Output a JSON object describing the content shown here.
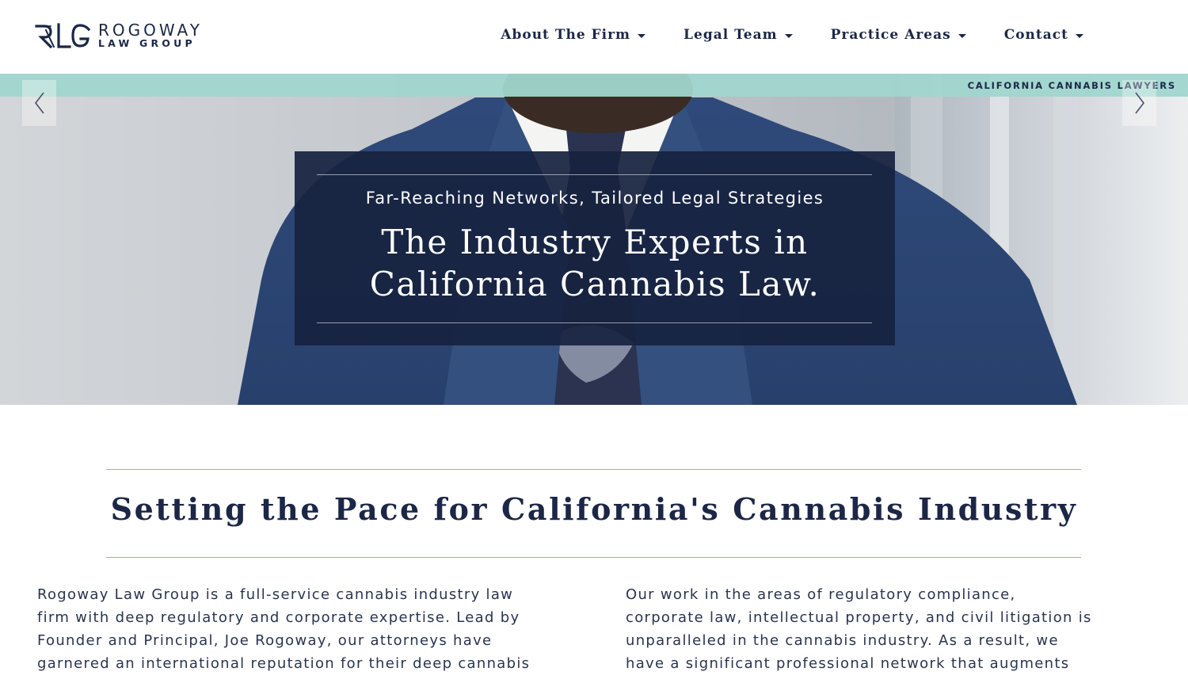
{
  "header": {
    "logo": {
      "mark": "RLG",
      "line1": "ROGOWAY",
      "line2": "LAW GROUP"
    },
    "nav": [
      {
        "label": "About The Firm"
      },
      {
        "label": "Legal Team"
      },
      {
        "label": "Practice Areas"
      },
      {
        "label": "Contact"
      }
    ]
  },
  "hero": {
    "ribbon_text": "CALIFORNIA CANNABIS LAWYERS",
    "kicker": "Far-Reaching Networks, Tailored Legal Strategies",
    "title_line1": "The Industry Experts in",
    "title_line2": "California Cannabis Law.",
    "prev_icon": "chevron-left-icon",
    "next_icon": "chevron-right-icon"
  },
  "intro": {
    "title": "Setting the Pace for California's Cannabis Industry",
    "left_lines": [
      "Rogoway Law Group is a full-service cannabis industry law",
      "firm with deep regulatory and corporate expertise. Lead by",
      "Founder and Principal, Joe Rogoway, our attorneys have",
      "garnered an international reputation for their deep cannabis"
    ],
    "right_lines": [
      "Our work in the areas of regulatory compliance,",
      "corporate law, intellectual property, and civil litigation is",
      "unparalleled in the cannabis industry. As a result, we",
      "have a significant professional network that augments"
    ]
  },
  "colors": {
    "navy": "#1c2747",
    "ribbon": "#a0d6ce",
    "gold": "#c8a868",
    "hero_box": "#172240"
  }
}
